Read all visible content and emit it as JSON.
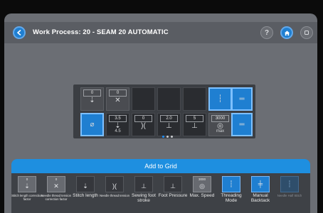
{
  "header": {
    "title": "Work Process: 20 - SEAM 20 AUTOMATIC",
    "help_label": "?"
  },
  "grid": {
    "cells": [
      {
        "value": "0",
        "value2": "",
        "icon": "stitch-length-correction-icon"
      },
      {
        "value": "0",
        "value2": "",
        "icon": "needle-thread-tension-correction-icon"
      },
      {
        "value": "",
        "icon": "empty"
      },
      {
        "value": "",
        "icon": "empty"
      },
      {
        "value": "",
        "icon": "empty"
      },
      {
        "value": "",
        "icon": "threading-icon"
      },
      {
        "value": "",
        "icon": "needle-change-icon"
      },
      {
        "value": "",
        "icon": "presser-foot-icon"
      },
      {
        "value": "3.5",
        "value2": "4.5",
        "icon": "stitch-length-icon"
      },
      {
        "value": "0",
        "value2": "",
        "icon": "thread-tension-icon"
      },
      {
        "value": "2.0",
        "value2": "",
        "icon": "foot-stroke-icon"
      },
      {
        "value": "5",
        "value2": "",
        "icon": "foot-pressure-icon"
      },
      {
        "value": "3000",
        "value2": "max",
        "icon": "speed-icon"
      },
      {
        "value": "",
        "icon": "manual-backtack-icon"
      }
    ]
  },
  "add_to_grid": "Add to Grid",
  "tools": [
    {
      "value": "0",
      "label": "Stitch length correction factor",
      "size": "small",
      "style": "gray"
    },
    {
      "value": "0",
      "label": "Needle thread tension correction factor",
      "size": "small",
      "style": "gray"
    },
    {
      "value": "",
      "label": "Stitch length",
      "size": "med",
      "style": "dark"
    },
    {
      "value": "",
      "label": "Needle thread tension",
      "size": "small",
      "style": "dark"
    },
    {
      "value": "",
      "label": "Sewing foot stroke",
      "size": "med",
      "style": "dark"
    },
    {
      "value": "",
      "label": "Foot Pressure",
      "size": "med",
      "style": "dark"
    },
    {
      "value": "3000",
      "label": "Max. Speed",
      "size": "med",
      "style": "gray"
    },
    {
      "value": "",
      "label": "Threading Mode",
      "size": "med",
      "style": "blue"
    },
    {
      "value": "",
      "label": "Manual Backtack",
      "size": "med",
      "style": "blue"
    },
    {
      "value": "",
      "label": "Needle Half Stitch",
      "size": "small",
      "style": "fade"
    }
  ],
  "colors": {
    "accent": "#1e8fe0",
    "panel": "#3e4146",
    "background": "#6b6e74"
  }
}
